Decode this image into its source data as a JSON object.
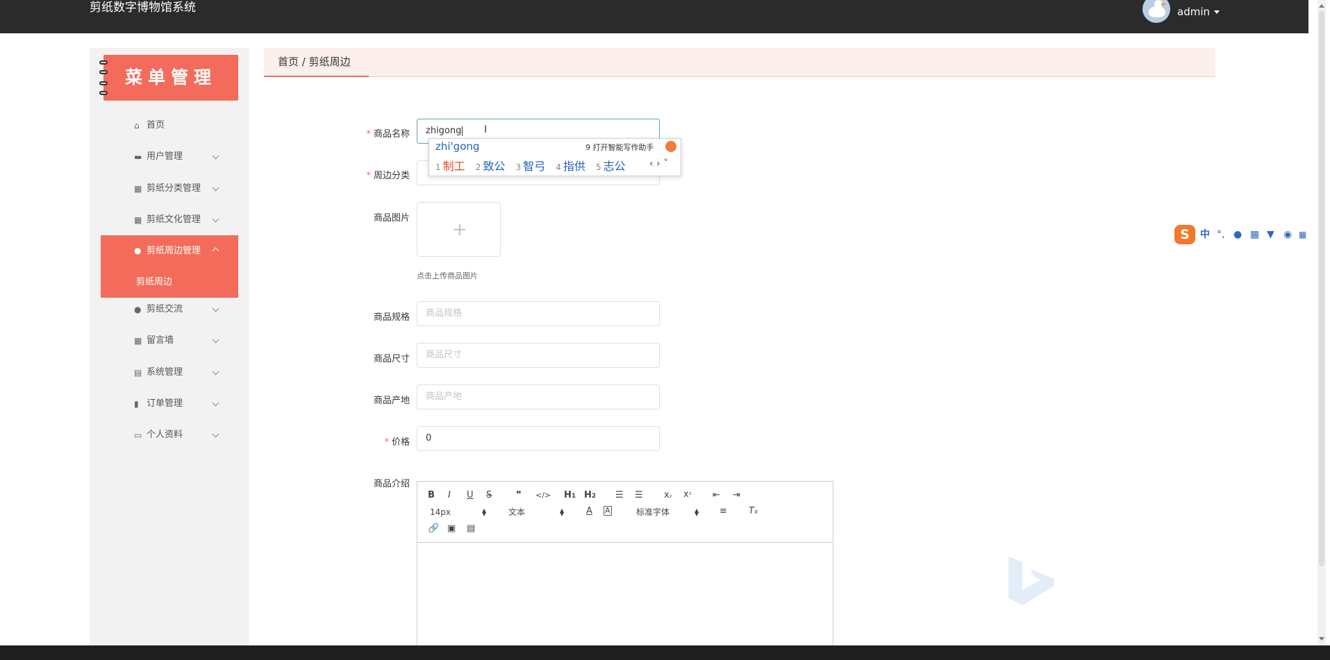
{
  "header": {
    "app_title": "剪纸数字博物馆系统",
    "username": "admin"
  },
  "sidebar": {
    "banner_title": "菜单管理",
    "items": [
      {
        "label": "首页",
        "icon": "home-icon"
      },
      {
        "label": "用户管理",
        "icon": "briefcase-icon"
      },
      {
        "label": "剪纸分类管理",
        "icon": "grid-icon"
      },
      {
        "label": "剪纸文化管理",
        "icon": "grid-icon"
      },
      {
        "label": "剪纸周边管理",
        "icon": "user-icon",
        "active": true
      },
      {
        "label": "剪纸周边",
        "submenu": true
      },
      {
        "label": "剪纸交流",
        "icon": "user-icon"
      },
      {
        "label": "留言墙",
        "icon": "grid-icon"
      },
      {
        "label": "系统管理",
        "icon": "clipboard-icon"
      },
      {
        "label": "订单管理",
        "icon": "bar-chart-icon"
      },
      {
        "label": "个人资料",
        "icon": "card-icon"
      }
    ]
  },
  "breadcrumb": "首页 / 剪纸周边",
  "form": {
    "name_label": "商品名称",
    "name_value": "zhigong",
    "category_label": "周边分类",
    "image_label": "商品图片",
    "upload_tip": "点击上传商品图片",
    "spec_label": "商品规格",
    "spec_placeholder": "商品规格",
    "size_label": "商品尺寸",
    "size_placeholder": "商品尺寸",
    "origin_label": "商品产地",
    "origin_placeholder": "商品产地",
    "price_label": "价格",
    "price_value": "0",
    "intro_label": "商品介绍"
  },
  "editor": {
    "font_size": "14px",
    "block_format": "文本",
    "font_family": "标准字体"
  },
  "ime": {
    "pinyin": "zhi'gong",
    "tip_number": "9",
    "tip": "打开智能写作助手",
    "candidates": [
      {
        "num": "1",
        "text": "制工"
      },
      {
        "num": "2",
        "text": "致公"
      },
      {
        "num": "3",
        "text": "智弓"
      },
      {
        "num": "4",
        "text": "指供"
      },
      {
        "num": "5",
        "text": "志公"
      }
    ]
  },
  "ime_bar": {
    "logo": "S",
    "mode": "中"
  },
  "colors": {
    "accent": "#f36c5b",
    "header_bg": "#2b2b2b",
    "sidebar_bg": "#f2f2f2",
    "required": "#f56c6c"
  }
}
